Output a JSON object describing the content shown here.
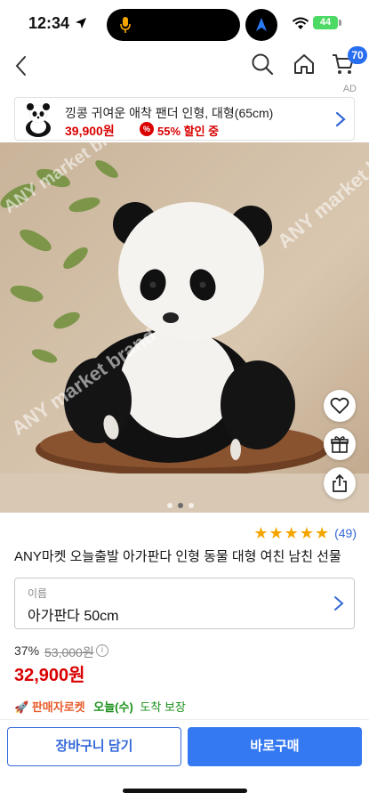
{
  "status_bar": {
    "time": "12:34",
    "battery": "44"
  },
  "nav": {
    "cart_count": "70",
    "ad_label": "AD"
  },
  "ad_banner": {
    "title": "낑콩 귀여운 애착 팬더 인형, 대형(65cm)",
    "price": "39,900원",
    "discount_badge": "%",
    "discount": "55% 할인 중"
  },
  "product_image": {
    "watermarks": [
      "ANY market brand",
      "ANY market brand",
      "ANY market brand"
    ],
    "page_count": 3,
    "active_page": 2
  },
  "rating": {
    "stars": 5,
    "review_count": "(49)"
  },
  "product": {
    "title": "ANY마켓 오늘출발 아가판다 인형 동물 대형 여친 남친 선물",
    "option_label": "이름",
    "option_value": "아가판다 50cm",
    "discount_rate": "37%",
    "original_price": "53,000원",
    "info": "i",
    "sale_price": "32,900원"
  },
  "delivery": {
    "rocket_label": "판매자로켓",
    "arrival_day": "오늘(수)",
    "arrival_guarantee": "도착 보장"
  },
  "actions": {
    "cart_button": "장바구니 담기",
    "buy_button": "바로구매"
  },
  "colors": {
    "accent": "#3479f2",
    "price_red": "#d90000",
    "star": "#f5a500",
    "arrival_green": "#1a8f1a",
    "rocket_orange": "#e85b2b"
  }
}
